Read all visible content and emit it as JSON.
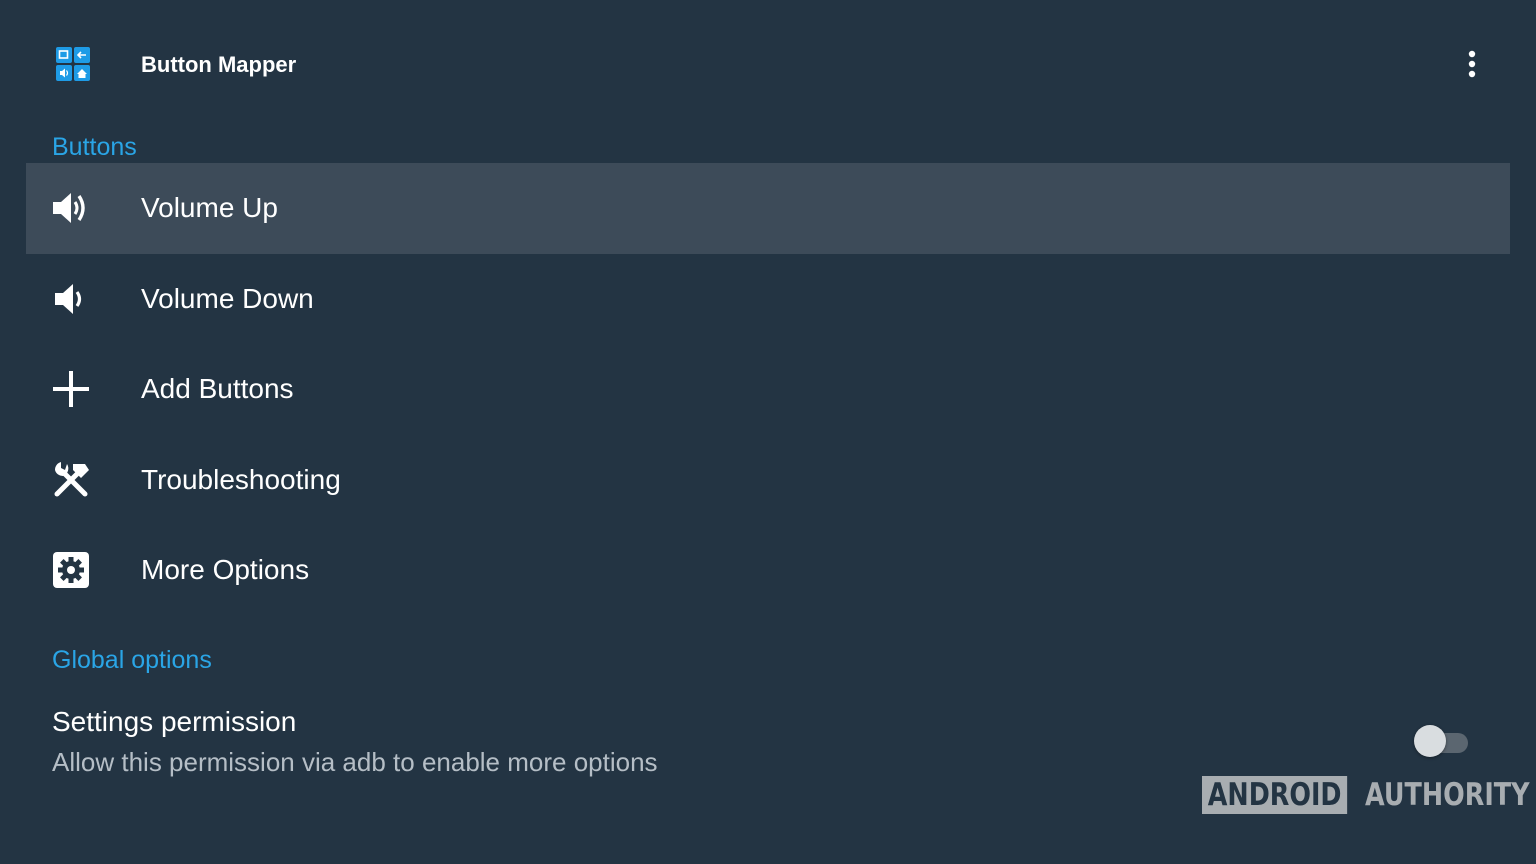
{
  "app_bar": {
    "title": "Button Mapper",
    "app_icon": "button-mapper-app-icon",
    "menu_icon": "more-vert-icon"
  },
  "sections": {
    "buttons_header": "Buttons",
    "global_header": "Global options"
  },
  "list": {
    "items": [
      {
        "label": "Volume Up",
        "icon": "volume-up-icon",
        "selected": true
      },
      {
        "label": "Volume Down",
        "icon": "volume-down-icon",
        "selected": false
      },
      {
        "label": "Add Buttons",
        "icon": "add-icon",
        "selected": false
      },
      {
        "label": "Troubleshooting",
        "icon": "tools-icon",
        "selected": false
      },
      {
        "label": "More Options",
        "icon": "settings-box-icon",
        "selected": false
      }
    ]
  },
  "settings_permission": {
    "title": "Settings permission",
    "summary": "Allow this permission via adb to enable more options",
    "enabled": false
  },
  "watermark": {
    "left": "ANDROID",
    "right": "AUTHORITY"
  },
  "colors": {
    "background": "#233443",
    "selected_row": "#3d4b59",
    "accent": "#2aa5e6",
    "secondary_text": "#b5bec6"
  }
}
